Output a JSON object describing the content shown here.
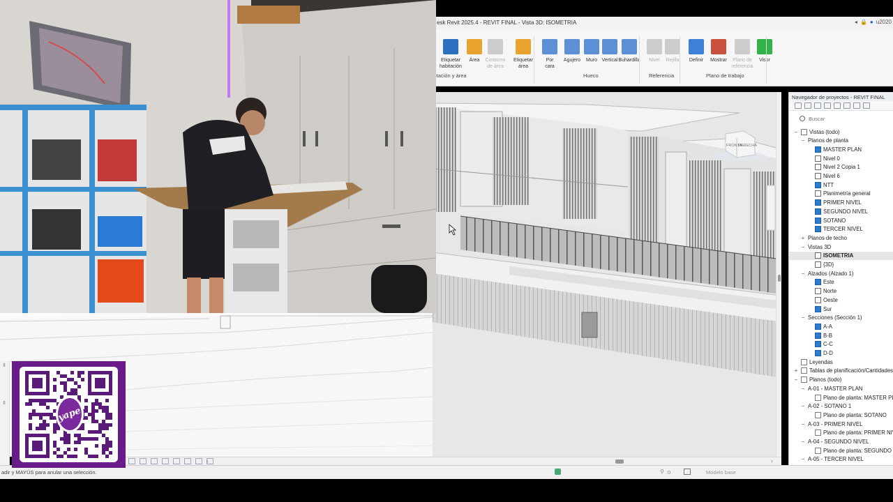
{
  "titlebar": {
    "title": "esk Revit 2025.4 - REVIT FINAL - Vista 3D: ISOMETRIA",
    "user": "u2020"
  },
  "ribbon": {
    "buttons": [
      {
        "label": "Etiquetar\nhabitación",
        "color": "#2d6fc0",
        "disabled": false
      },
      {
        "label": "Área",
        "color": "#e8a42c",
        "disabled": false
      },
      {
        "label": "Contorno\nde área",
        "color": "#cccccc",
        "disabled": true
      },
      {
        "label": "Etiquetar\nárea",
        "color": "#e8a42c",
        "disabled": false
      },
      {
        "label": "Por\ncara",
        "color": "#5b8fd6",
        "disabled": false
      },
      {
        "label": "Agujero",
        "color": "#5b8fd6",
        "disabled": false
      },
      {
        "label": "Muro",
        "color": "#5b8fd6",
        "disabled": false
      },
      {
        "label": "Vertical",
        "color": "#5b8fd6",
        "disabled": false
      },
      {
        "label": "Buhardilla",
        "color": "#5b8fd6",
        "disabled": false
      },
      {
        "label": "Nivel",
        "color": "#cccccc",
        "disabled": true
      },
      {
        "label": "Rejilla",
        "color": "#cccccc",
        "disabled": true
      },
      {
        "label": "Definir",
        "color": "#3d7fd9",
        "disabled": false
      },
      {
        "label": "Mostrar",
        "color": "#c8503c",
        "disabled": false
      },
      {
        "label": "Plano de\nreferencia",
        "color": "#cccccc",
        "disabled": true
      },
      {
        "label": "Visor",
        "color": "#2fb34a",
        "disabled": false
      }
    ],
    "panels": {
      "room_area": "itación y área",
      "opening": "Hueco",
      "reference": "Referencia",
      "work_plane": "Plano de trabajo"
    }
  },
  "viewcube": {
    "face_front": "FRONTAL",
    "face_right": "DERECHA"
  },
  "browser": {
    "title": "Navegador de proyectos - REVIT FINAL",
    "search_placeholder": "Buscar",
    "tree": [
      {
        "label": "Vistas (todo)",
        "toggle": "−",
        "indent": 0,
        "icon": "sheet"
      },
      {
        "label": "Planos de planta",
        "toggle": "−",
        "indent": 1,
        "icon": ""
      },
      {
        "label": "MASTER PLAN",
        "toggle": "",
        "indent": 2,
        "icon": "plan"
      },
      {
        "label": "Nivel 0",
        "toggle": "",
        "indent": 2,
        "icon": "blank"
      },
      {
        "label": "Nivel 2 Copia 1",
        "toggle": "",
        "indent": 2,
        "icon": "blank"
      },
      {
        "label": "Nivel 6",
        "toggle": "",
        "indent": 2,
        "icon": "blank"
      },
      {
        "label": "NTT",
        "toggle": "",
        "indent": 2,
        "icon": "plan"
      },
      {
        "label": "Planimetría general",
        "toggle": "",
        "indent": 2,
        "icon": "blank"
      },
      {
        "label": "PRIMER NIVEL",
        "toggle": "",
        "indent": 2,
        "icon": "plan"
      },
      {
        "label": "SEGUNDO NIVEL",
        "toggle": "",
        "indent": 2,
        "icon": "plan"
      },
      {
        "label": "SOTANO",
        "toggle": "",
        "indent": 2,
        "icon": "plan"
      },
      {
        "label": "TERCER NIVEL",
        "toggle": "",
        "indent": 2,
        "icon": "plan"
      },
      {
        "label": "Planos de techo",
        "toggle": "+",
        "indent": 1,
        "icon": ""
      },
      {
        "label": "Vistas 3D",
        "toggle": "−",
        "indent": 1,
        "icon": ""
      },
      {
        "label": "ISOMETRIA",
        "toggle": "",
        "indent": 2,
        "icon": "blank",
        "selected": true
      },
      {
        "label": "{3D}",
        "toggle": "",
        "indent": 2,
        "icon": "blank"
      },
      {
        "label": "Alzados (Alzado 1)",
        "toggle": "−",
        "indent": 1,
        "icon": ""
      },
      {
        "label": "Este",
        "toggle": "",
        "indent": 2,
        "icon": "plan"
      },
      {
        "label": "Norte",
        "toggle": "",
        "indent": 2,
        "icon": "blank"
      },
      {
        "label": "Oeste",
        "toggle": "",
        "indent": 2,
        "icon": "blank"
      },
      {
        "label": "Sur",
        "toggle": "",
        "indent": 2,
        "icon": "plan"
      },
      {
        "label": "Secciones (Sección 1)",
        "toggle": "−",
        "indent": 1,
        "icon": ""
      },
      {
        "label": "A-A",
        "toggle": "",
        "indent": 2,
        "icon": "plan"
      },
      {
        "label": "B-B",
        "toggle": "",
        "indent": 2,
        "icon": "plan"
      },
      {
        "label": "C-C",
        "toggle": "",
        "indent": 2,
        "icon": "plan"
      },
      {
        "label": "D-D",
        "toggle": "",
        "indent": 2,
        "icon": "plan"
      },
      {
        "label": "Leyendas",
        "toggle": "",
        "indent": 0,
        "icon": "sheet"
      },
      {
        "label": "Tablas de planificación/Cantidades (",
        "toggle": "+",
        "indent": 0,
        "icon": "sheet"
      },
      {
        "label": "Planos (todo)",
        "toggle": "−",
        "indent": 0,
        "icon": "sheet"
      },
      {
        "label": "A-01 - MASTER PLAN",
        "toggle": "−",
        "indent": 1,
        "icon": ""
      },
      {
        "label": "Plano de planta: MASTER PLA",
        "toggle": "",
        "indent": 2,
        "icon": "sheet"
      },
      {
        "label": "A-02 - SOTANO 1",
        "toggle": "−",
        "indent": 1,
        "icon": ""
      },
      {
        "label": "Plano de planta: SOTANO",
        "toggle": "",
        "indent": 2,
        "icon": "sheet"
      },
      {
        "label": "A-03 - PRIMER NIVEL",
        "toggle": "−",
        "indent": 1,
        "icon": ""
      },
      {
        "label": "Plano de planta: PRIMER NIVE",
        "toggle": "",
        "indent": 2,
        "icon": "sheet"
      },
      {
        "label": "A-04 - SEGUNDO NIVEL",
        "toggle": "−",
        "indent": 1,
        "icon": ""
      },
      {
        "label": "Plano de planta: SEGUNDO N",
        "toggle": "",
        "indent": 2,
        "icon": "sheet"
      },
      {
        "label": "A-05 - TERCER NIVEL",
        "toggle": "−",
        "indent": 1,
        "icon": ""
      }
    ]
  },
  "statusbar": {
    "message": "adir y MAYÚS para anular una selección.",
    "model": "Modelo base",
    "filter_count": ":0"
  },
  "qr": {
    "brand": "yape"
  }
}
